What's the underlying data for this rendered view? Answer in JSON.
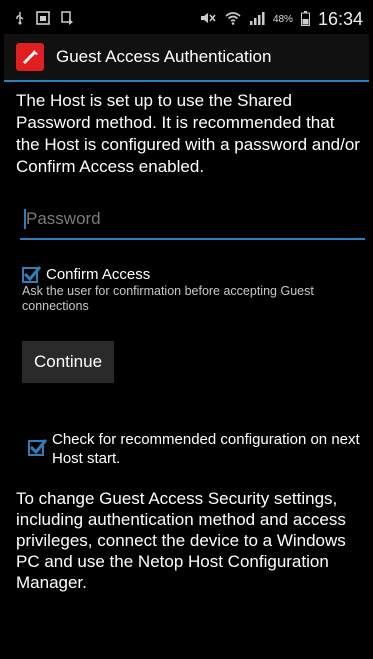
{
  "status_bar": {
    "battery_percent": "48%",
    "time": "16:34"
  },
  "action_bar": {
    "title": "Guest Access Authentication"
  },
  "intro_text": "The Host is set up to use the Shared Password method. It is recommended that the Host is configured with a password and/or Confirm Access enabled.",
  "password_field": {
    "placeholder": "Password",
    "value": ""
  },
  "confirm_access": {
    "label": "Confirm Access",
    "checked": true,
    "description": "Ask the user for confirmation before accepting Guest connections"
  },
  "continue_button": {
    "label": "Continue"
  },
  "recommended_config": {
    "label": "Check for recommended configuration on next Host start.",
    "checked": true
  },
  "outro_text": "To change Guest Access Security settings, including authentication method and access privileges, connect the device to a Windows PC and use the Netop Host Configuration Manager.",
  "colors": {
    "accent": "#2c7fb8",
    "app_icon": "#e02020",
    "background": "#000000"
  }
}
